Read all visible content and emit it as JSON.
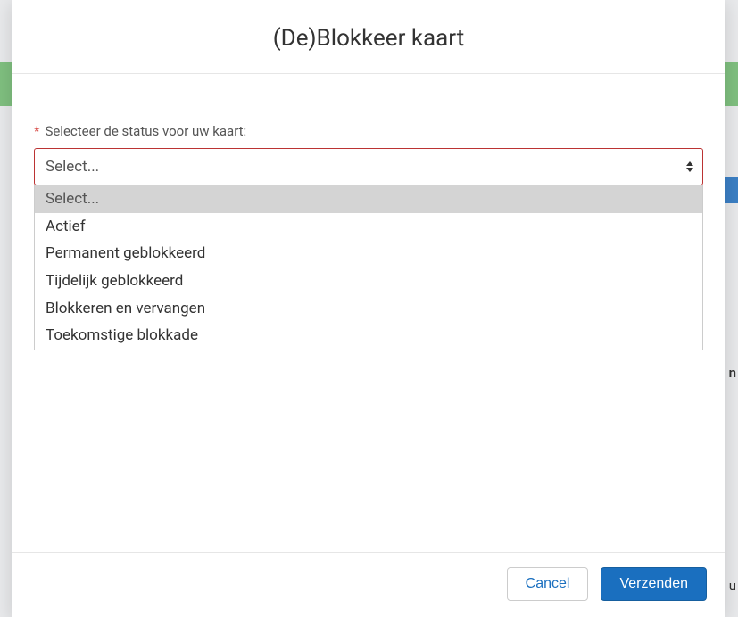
{
  "backdrop": {
    "text1": "n",
    "text2": "u"
  },
  "modal": {
    "title": "(De)Blokkeer kaart",
    "field_label": "Selecteer de status voor uw kaart:",
    "required_marker": "*",
    "select_placeholder": "Select...",
    "options": [
      {
        "label": "Select...",
        "is_placeholder": true
      },
      {
        "label": "Actief",
        "is_placeholder": false
      },
      {
        "label": "Permanent geblokkeerd",
        "is_placeholder": false
      },
      {
        "label": "Tijdelijk geblokkeerd",
        "is_placeholder": false
      },
      {
        "label": "Blokkeren en vervangen",
        "is_placeholder": false
      },
      {
        "label": "Toekomstige blokkade",
        "is_placeholder": false
      }
    ],
    "footer": {
      "cancel": "Cancel",
      "submit": "Verzenden"
    }
  },
  "colors": {
    "primary": "#1a6fbf",
    "error_border": "#b33",
    "green_bg": "#7fbf7f"
  }
}
